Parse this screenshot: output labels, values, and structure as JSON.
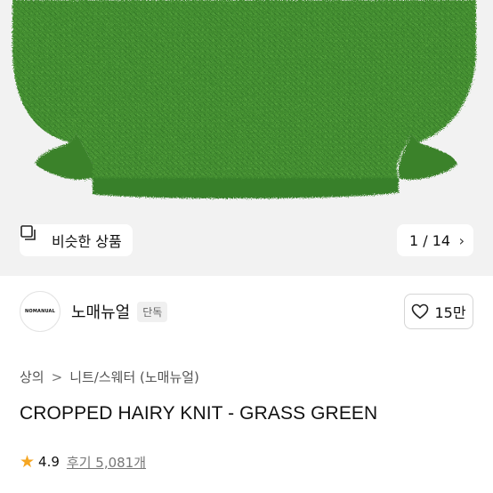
{
  "gallery": {
    "similar_products_label": "비슷한 상품",
    "pager_current": "1 / 14",
    "pager_next_icon": "chevron-right-icon",
    "image_color": "#3f8a2f"
  },
  "brand": {
    "logo_text": "NOMANUAL",
    "name": "노매뉴얼",
    "badge": "단독",
    "like_count": "15만"
  },
  "breadcrumb": {
    "level1": "상의",
    "level2": "니트/스웨터 (노매뉴얼)"
  },
  "product": {
    "title": "CROPPED HAIRY KNIT - GRASS GREEN",
    "rating": "4.9",
    "reviews": "후기 5,081개"
  }
}
